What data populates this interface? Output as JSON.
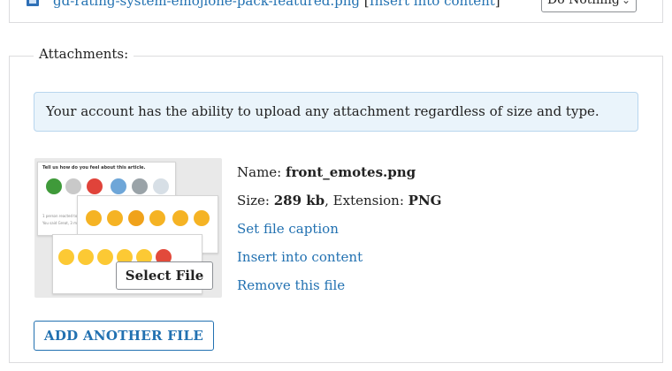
{
  "top": {
    "file_link": "gd-rating-system-emojione-pack-featured.png",
    "insert_link": "Insert into content",
    "action_select": "Do Nothing"
  },
  "attachments": {
    "legend": "Attachments:",
    "notice": "Your account has the ability to upload any attachment regardless of size and type.",
    "file": {
      "name_label": "Name:",
      "name_value": "front_emotes.png",
      "size_label": "Size:",
      "size_value": "289 kb",
      "ext_label": ", Extension:",
      "ext_value": "PNG",
      "thumb_card_title": "Tell us how do you feel about this article.",
      "thumb_card_foot_1": "1 person reacted to this.",
      "thumb_card_foot_2": "You said Great, 3 min ago."
    },
    "select_file_button": "Select File",
    "set_caption_link": "Set file caption",
    "insert_content_link": "Insert into content",
    "remove_link": "Remove this file",
    "add_another_button": "ADD ANOTHER FILE"
  }
}
